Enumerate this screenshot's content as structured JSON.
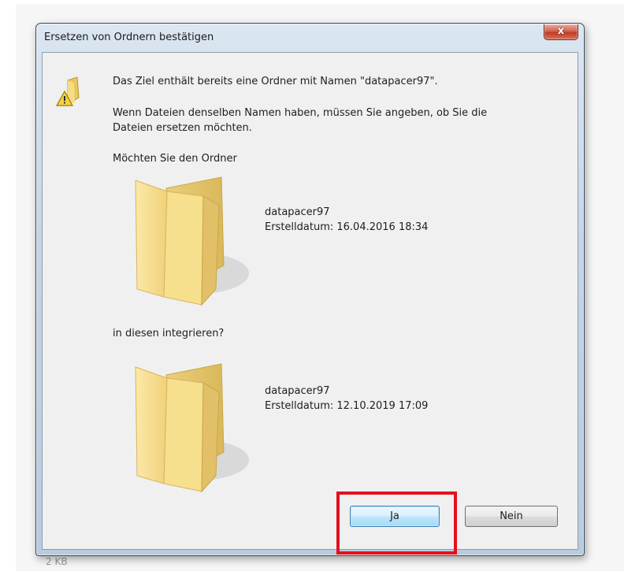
{
  "window": {
    "title": "Ersetzen von Ordnern bestätigen",
    "close_glyph": "x"
  },
  "message": {
    "line1": "Das Ziel enthält bereits eine Ordner mit Namen \"datapacer97\".",
    "line2": "Wenn Dateien denselben Namen haben, müssen Sie angeben, ob Sie die",
    "line3": "Dateien ersetzen möchten.",
    "line4": "Möchten Sie den Ordner"
  },
  "source_folder": {
    "name": "datapacer97",
    "created": "Erstelldatum: 16.04.2016 18:34"
  },
  "merge_question": "in diesen integrieren?",
  "target_folder": {
    "name": "datapacer97",
    "created": "Erstelldatum: 12.10.2019 17:09"
  },
  "buttons": {
    "yes": "Ja",
    "no": "Nein"
  },
  "below_window_text": "2 KB",
  "icons": {
    "warning": "warning-folder-icon",
    "folder": "folder-icon",
    "close": "close-icon"
  },
  "colors": {
    "highlight": "#e3111c",
    "close_button": "#c23b22",
    "dialog_background": "#f0f0f0"
  }
}
